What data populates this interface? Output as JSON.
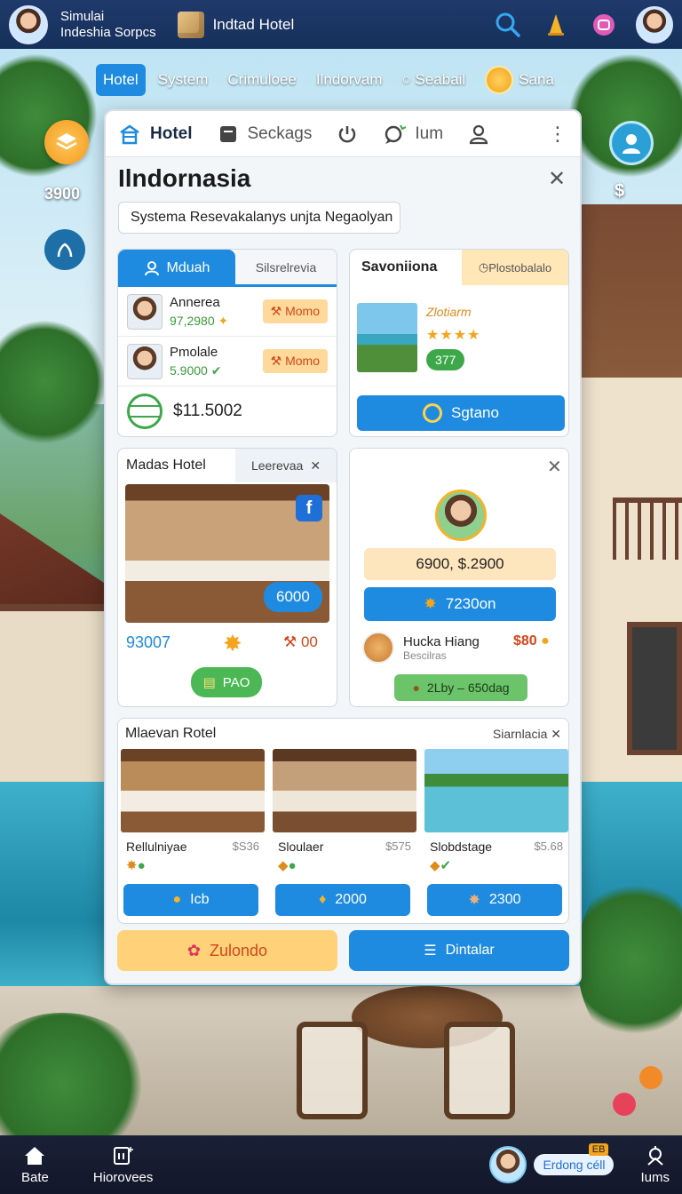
{
  "topbar": {
    "title_line1": "Simulai",
    "title_line2": "Indeshia Sorpcs",
    "hotel_label": "Indtad Hotel",
    "icons": [
      "search-icon",
      "bell-icon",
      "chat-icon",
      "avatar"
    ]
  },
  "tabs": [
    "Hotel",
    "System",
    "Crimuloee",
    "Ilndorvam",
    "Seabail",
    "Sana"
  ],
  "left": {
    "count": "3900"
  },
  "right": {
    "money": "$"
  },
  "panel": {
    "tabs": [
      "Hotel",
      "Seckags",
      "",
      "Ium"
    ],
    "title": "Ilndornasia",
    "subtitle": "Systema Resevakalanys unjta Negaolyan"
  },
  "card_guests": {
    "tab_active": "Mduah",
    "tab_inactive": "Silsrelrevia",
    "guests": [
      {
        "name": "Annerea",
        "value": "97,2980",
        "action": "Momo"
      },
      {
        "name": "Pmolale",
        "value": "5.9000",
        "action": "Momo"
      }
    ],
    "total": "$11.5002"
  },
  "card_resort": {
    "tab_title": "Savoniiona",
    "tab_side": "Plostobalalo",
    "name": "Zlotiarm",
    "stars": "★★★★",
    "score": "377",
    "button": "Sgtano"
  },
  "card_hotel": {
    "title": "Madas Hotel",
    "tab_side": "Leerevaa",
    "price_pill": "6000",
    "number": "93007",
    "tag": "00",
    "button": "PAO"
  },
  "card_profile": {
    "range": "6900, $.2900",
    "button": "7230on",
    "item_name": "Hucka Hiang",
    "item_sub": "Bescilras",
    "item_price": "$80",
    "green_button": "2Lby – 650dag"
  },
  "card_rooms": {
    "title": "Mlaevan Rotel",
    "side": "Siarnlacia",
    "rooms": [
      {
        "name": "Rellulniyae",
        "price": "$S36",
        "button": "Icb"
      },
      {
        "name": "Sloulaer",
        "price": "$575",
        "button": "2000"
      },
      {
        "name": "Slobdstage",
        "price": "$5.68",
        "button": "2300"
      }
    ]
  },
  "actions": {
    "yellow": "Zulondo",
    "blue": "Dintalar"
  },
  "bottombar": {
    "home": "Bate",
    "history": "Hiorovees",
    "cell": "Erdong céll",
    "cell_badge": "EB",
    "items": "Iums"
  }
}
